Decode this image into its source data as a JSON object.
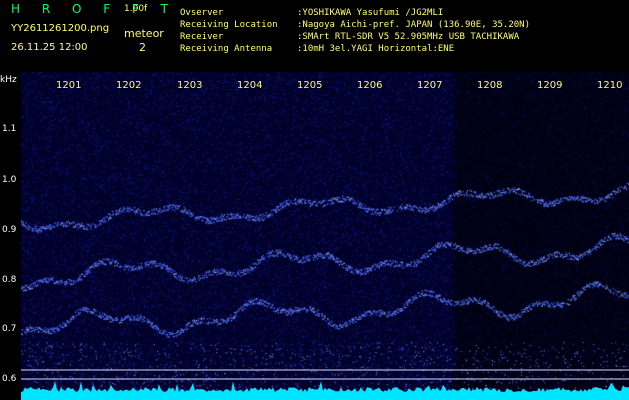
{
  "header": {
    "brand": "H R O F F T",
    "version": "1.00f",
    "filename": "YY2611261200.png",
    "timestamp": "26.11.25 12:00",
    "meteor_label": "meteor",
    "meteor_count": "2"
  },
  "station": {
    "observer_label": "Ovserver",
    "observer": ":YOSHIKAWA Yasufumi /JG2MLI",
    "location_label": "Receiving Location",
    "location": ":Nagoya Aichi-pref. JAPAN (136.90E, 35.20N)",
    "receiver_label": "Receiver",
    "receiver": ":SMArt RTL-SDR V5 52.905MHz USB TACHIKAWA",
    "antenna_label": "Receiving Antenna",
    "antenna": ":10mH 3el.YAGI Horizontal:ENE"
  },
  "axes": {
    "unit": "kHz",
    "y_ticks": [
      "1.1",
      "1.0",
      "0.9",
      "0.8",
      "0.7",
      "0.6"
    ],
    "x_ticks": [
      "1201",
      "1202",
      "1203",
      "1204",
      "1205",
      "1206",
      "1207",
      "1208",
      "1209",
      "1210"
    ]
  },
  "colors": {
    "background": "#000000",
    "plot_background": "#00002a",
    "signal": "#4a6bff",
    "baseline": "#00e5ff",
    "header_text": "#ffff66",
    "brand_text": "#00ff66",
    "axis_text": "#ffffff"
  }
}
